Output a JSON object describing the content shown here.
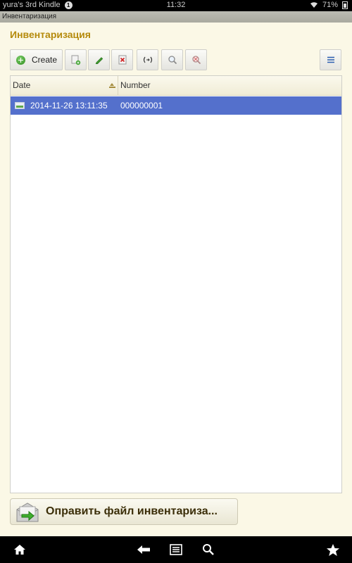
{
  "status_bar": {
    "device_name": "yura's 3rd Kindle",
    "notification_count": "1",
    "time": "11:32",
    "battery": "71%"
  },
  "window": {
    "title": "Инвентаризация"
  },
  "page": {
    "title": "Инвентаризация"
  },
  "toolbar": {
    "create_label": "Create",
    "copy_icon": "copy-icon",
    "edit_icon": "pencil-icon",
    "delete_icon": "delete-mark-icon",
    "code_icon": "code-brackets-icon",
    "search_icon": "search-icon",
    "clear_search_icon": "clear-search-icon",
    "menu_icon": "menu-icon"
  },
  "table": {
    "columns": [
      "Date",
      "Number"
    ],
    "sorted_column": "Date",
    "rows": [
      {
        "date": "2014-11-26 13:11:35",
        "number": "000000001",
        "selected": true
      }
    ]
  },
  "actions": {
    "send_file_label": "Оправить файл инвентариза..."
  },
  "nav_bar": {
    "items": [
      "home-icon",
      "back-icon",
      "menu-icon",
      "search-icon",
      "favorites-icon"
    ]
  },
  "colors": {
    "background": "#fbf8e6",
    "title": "#b58a0b",
    "selection": "#5470cc",
    "header": "#f0ecd6"
  }
}
